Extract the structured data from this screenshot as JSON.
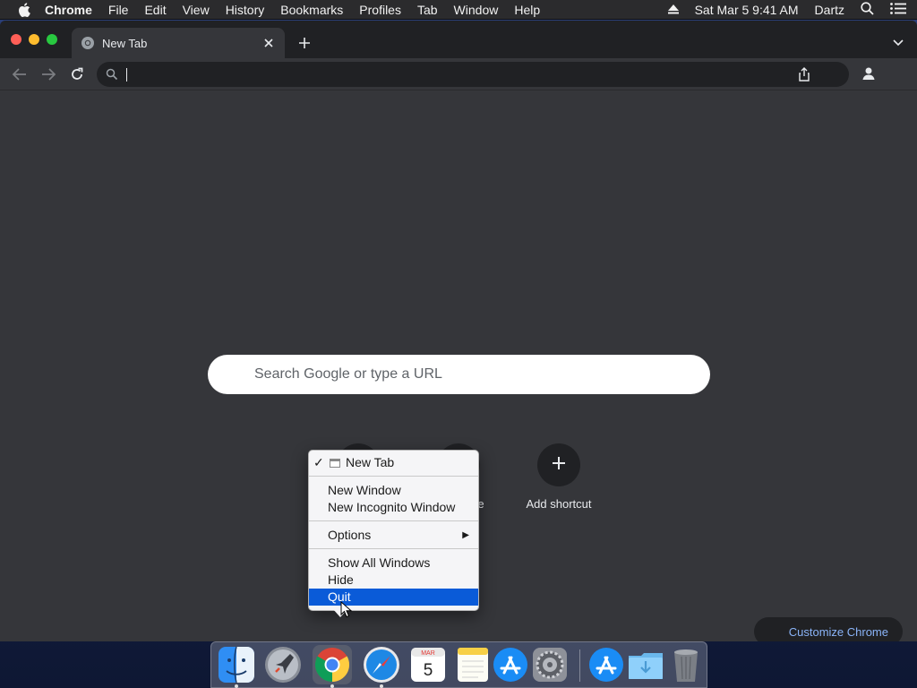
{
  "menubar": {
    "app_name": "Chrome",
    "items": [
      "File",
      "Edit",
      "View",
      "History",
      "Bookmarks",
      "Profiles",
      "Tab",
      "Window",
      "Help"
    ],
    "datetime": "Sat Mar 5  9:41 AM",
    "user": "Dartz"
  },
  "tabs": [
    {
      "label": "New Tab",
      "active": true
    }
  ],
  "omnibox": {
    "value": "",
    "placeholder": ""
  },
  "ntp": {
    "search_placeholder": "Search Google or type a URL",
    "shortcuts": [
      {
        "label": "",
        "icon": "youtube-icon"
      },
      {
        "label": "e",
        "icon": "notes-icon"
      },
      {
        "label": "Add shortcut",
        "icon": "plus-icon"
      }
    ],
    "customize_label": "Customize Chrome"
  },
  "dock_menu": {
    "items": [
      {
        "label": "New Tab",
        "checked": true
      },
      {
        "label": "New Window"
      },
      {
        "label": "New Incognito Window"
      },
      {
        "label": "Options",
        "submenu": true
      },
      {
        "label": "Show All Windows"
      },
      {
        "label": "Hide"
      },
      {
        "label": "Quit",
        "highlighted": true
      }
    ]
  },
  "dock": {
    "apps": [
      "Finder",
      "Launchpad",
      "Google Chrome",
      "Safari",
      "Calendar",
      "Notes",
      "App Store",
      "System Preferences",
      "App Store",
      "Downloads",
      "Trash"
    ],
    "calendar_month": "MAR",
    "calendar_day": "5"
  },
  "colors": {
    "window_bg": "#35363a",
    "tabstrip_bg": "#202124",
    "accent_link": "#8ab4f8",
    "menu_highlight": "#0a5bd8"
  }
}
